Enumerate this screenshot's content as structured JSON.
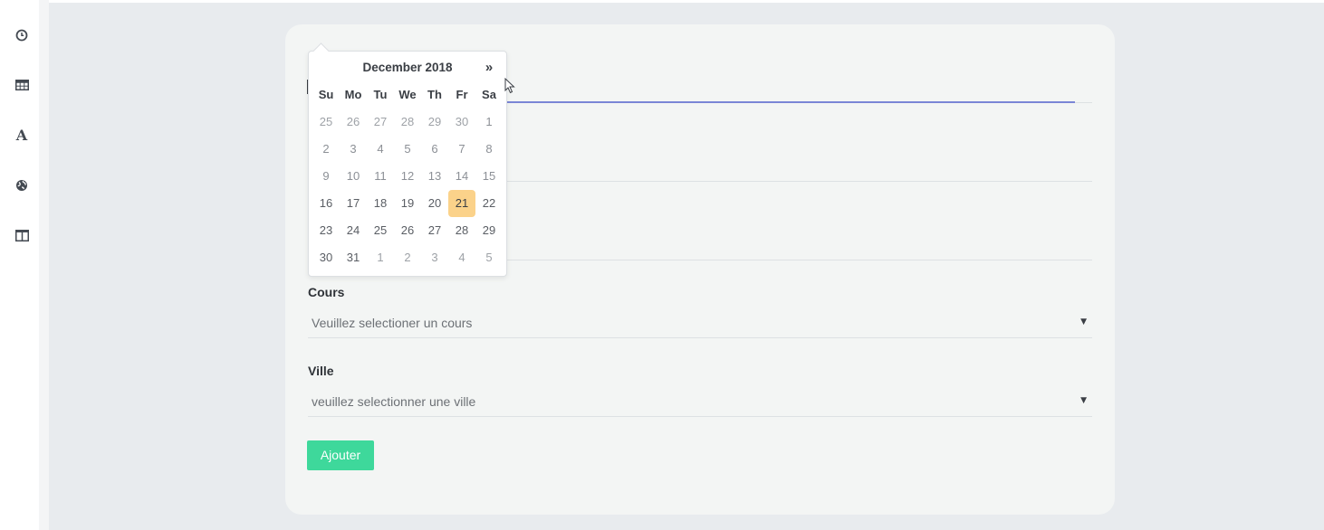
{
  "sidebar": {
    "icons": [
      {
        "name": "clock-icon",
        "glyph": ""
      },
      {
        "name": "table-icon",
        "glyph": ""
      },
      {
        "name": "font-icon",
        "glyph": "A"
      },
      {
        "name": "globe-icon",
        "glyph": ""
      },
      {
        "name": "columns-icon",
        "glyph": ""
      }
    ]
  },
  "datepicker": {
    "month_title": "December 2018",
    "next_label": "»",
    "weekdays": [
      "Su",
      "Mo",
      "Tu",
      "We",
      "Th",
      "Fr",
      "Sa"
    ],
    "weeks": [
      [
        "25",
        "26",
        "27",
        "28",
        "29",
        "30",
        "1"
      ],
      [
        "2",
        "3",
        "4",
        "5",
        "6",
        "7",
        "8"
      ],
      [
        "9",
        "10",
        "11",
        "12",
        "13",
        "14",
        "15"
      ],
      [
        "16",
        "17",
        "18",
        "19",
        "20",
        "21",
        "22"
      ],
      [
        "23",
        "24",
        "25",
        "26",
        "27",
        "28",
        "29"
      ],
      [
        "30",
        "31",
        "1",
        "2",
        "3",
        "4",
        "5"
      ]
    ],
    "selected_day": "21",
    "highlight_color": "#fbd28a"
  },
  "form": {
    "cours": {
      "label": "Cours",
      "value": "Veuillez selectioner un cours"
    },
    "ville": {
      "label": "Ville",
      "value": "veuillez selectionner une ville"
    },
    "submit_label": "Ajouter",
    "accent_color": "#3ed89b"
  }
}
